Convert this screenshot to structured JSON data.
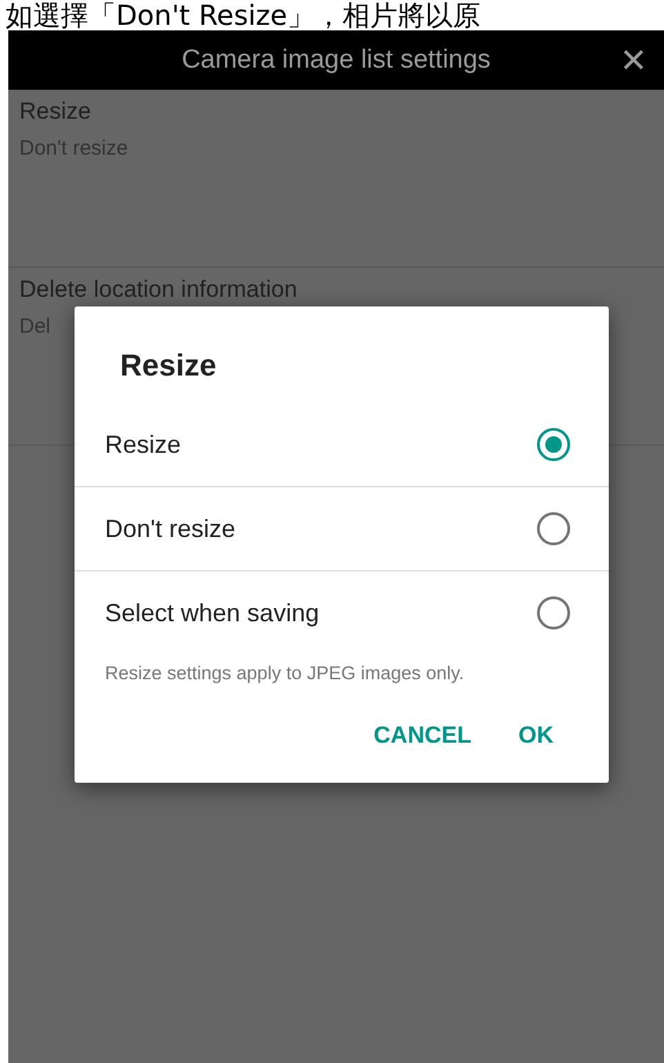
{
  "caption": "如選擇「Don't Resize」，相片將以原",
  "header": {
    "title": "Camera image list settings",
    "close": "✕"
  },
  "settings": [
    {
      "title": "Resize",
      "subtitle": "Don't resize"
    },
    {
      "title": "Delete location information",
      "subtitle": "Del"
    }
  ],
  "dialog": {
    "title": "Resize",
    "options": [
      {
        "label": "Resize",
        "selected": true
      },
      {
        "label": "Don't resize",
        "selected": false
      },
      {
        "label": "Select when saving",
        "selected": false
      }
    ],
    "note": "Resize settings apply to JPEG images only.",
    "buttons": [
      "CANCEL",
      "OK"
    ]
  }
}
